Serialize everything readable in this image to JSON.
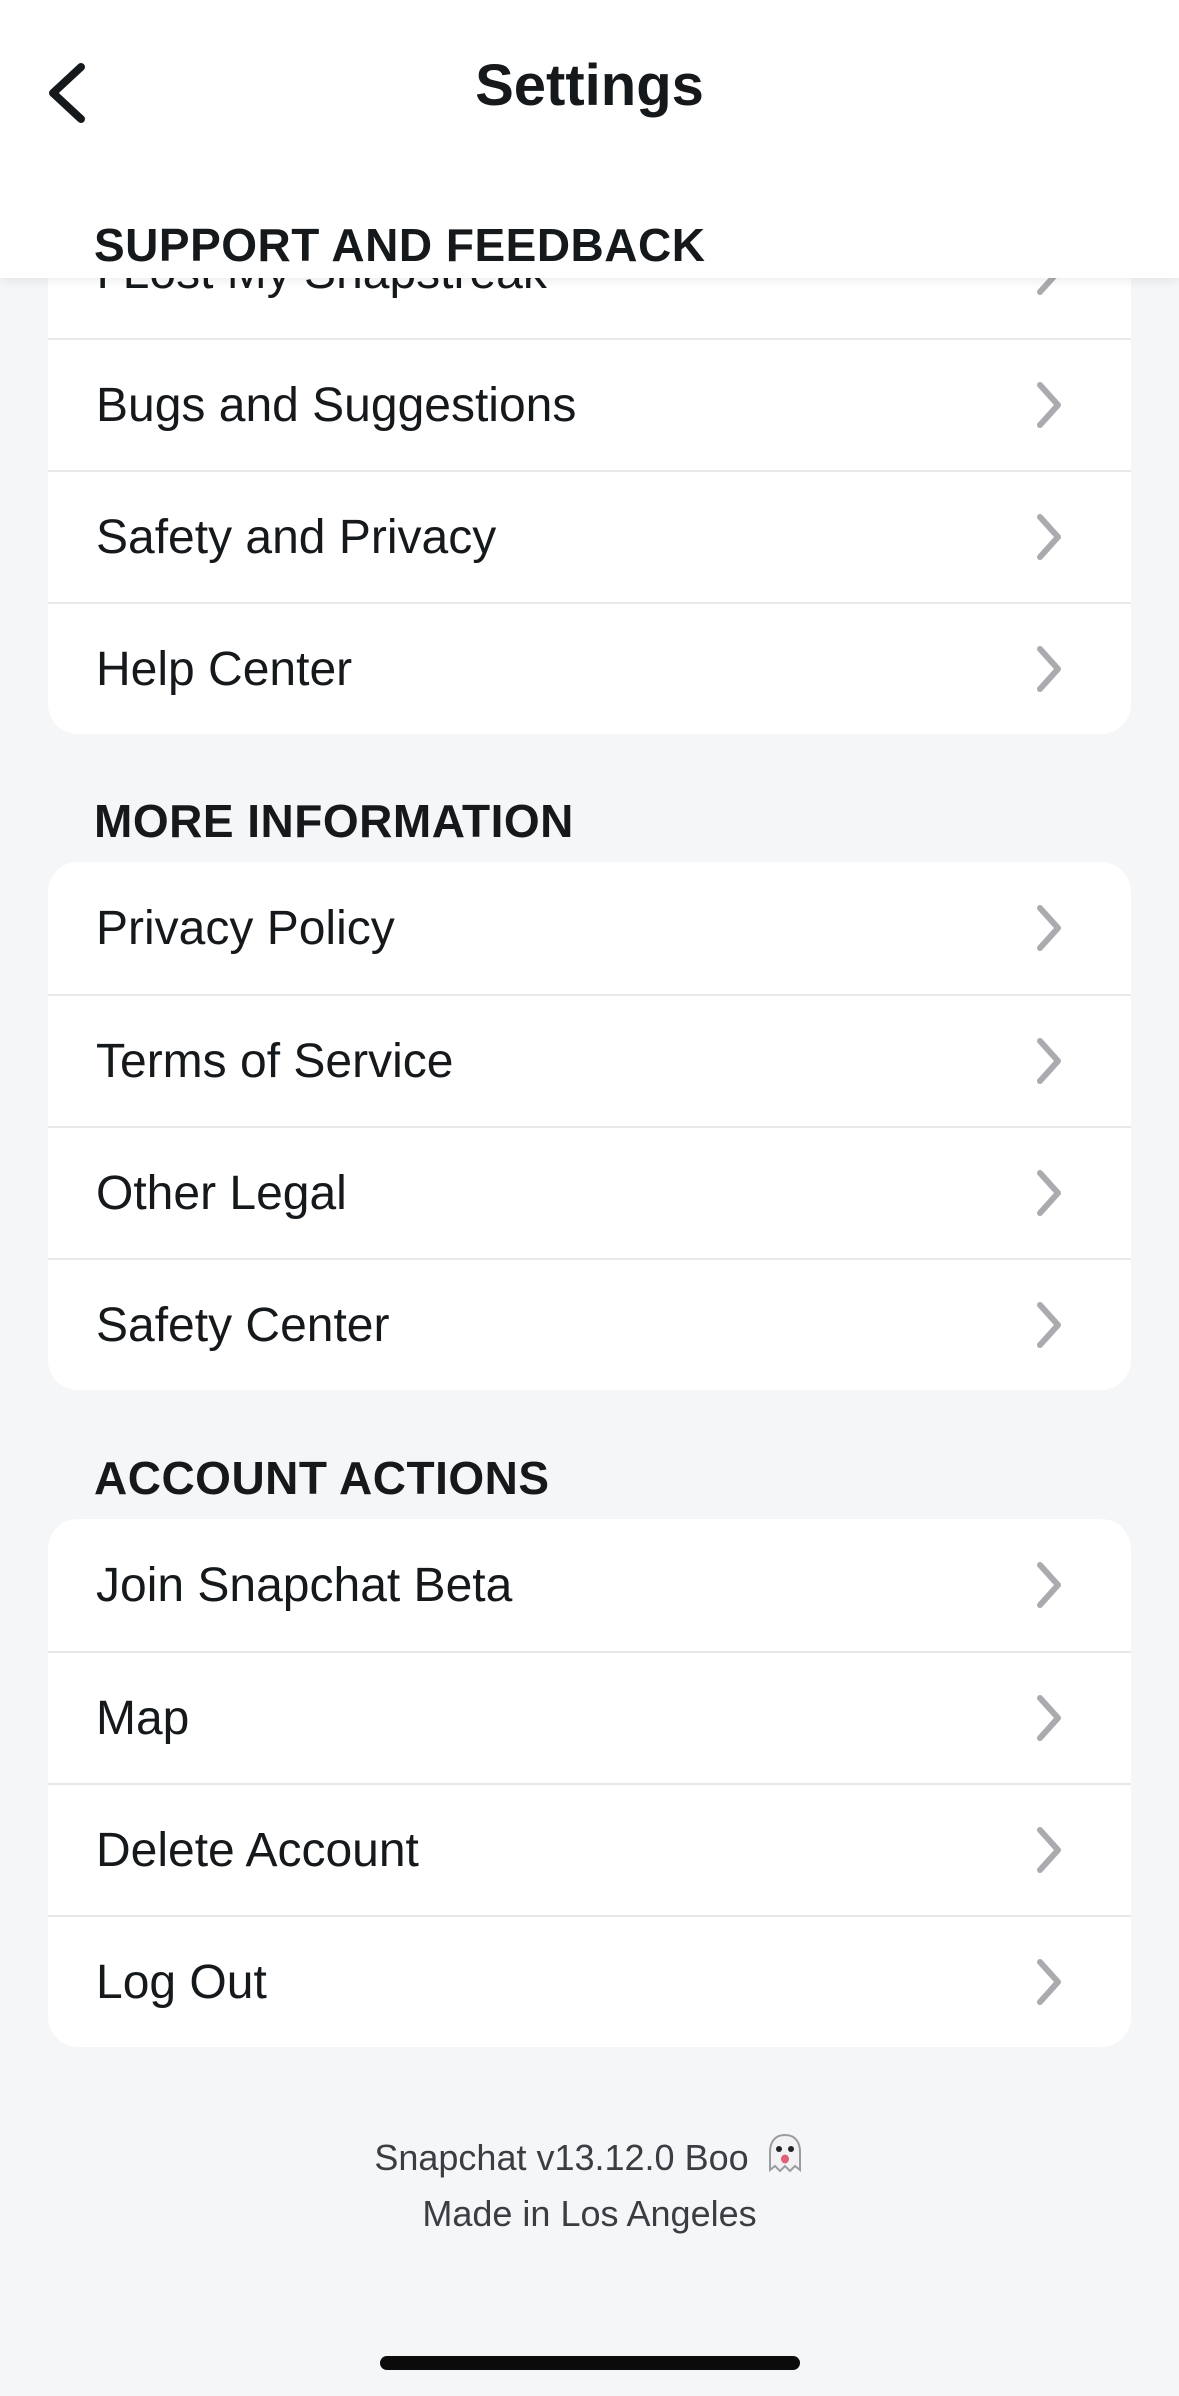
{
  "header": {
    "title": "Settings",
    "section_label": "SUPPORT AND FEEDBACK"
  },
  "support": {
    "partial_item": "I Lost My Snapstreak",
    "items": [
      {
        "label": "Bugs and Suggestions"
      },
      {
        "label": "Safety and Privacy"
      },
      {
        "label": "Help Center"
      }
    ]
  },
  "more_info": {
    "title": "MORE INFORMATION",
    "items": [
      {
        "label": "Privacy Policy"
      },
      {
        "label": "Terms of Service"
      },
      {
        "label": "Other Legal"
      },
      {
        "label": "Safety Center"
      }
    ]
  },
  "account_actions": {
    "title": "ACCOUNT ACTIONS",
    "items": [
      {
        "label": "Join Snapchat Beta"
      },
      {
        "label": "Map"
      },
      {
        "label": "Delete Account"
      },
      {
        "label": "Log Out"
      }
    ]
  },
  "footer": {
    "version": "Snapchat v13.12.0 Boo",
    "made_in": "Made in Los Angeles"
  },
  "colors": {
    "background": "#f5f6f8",
    "card": "#ffffff",
    "chevron": "#a9abae",
    "text": "#16191c"
  },
  "icons": {
    "back": "chevron-left-icon",
    "row": "chevron-right-icon",
    "footer": "ghost-emoji-icon"
  }
}
